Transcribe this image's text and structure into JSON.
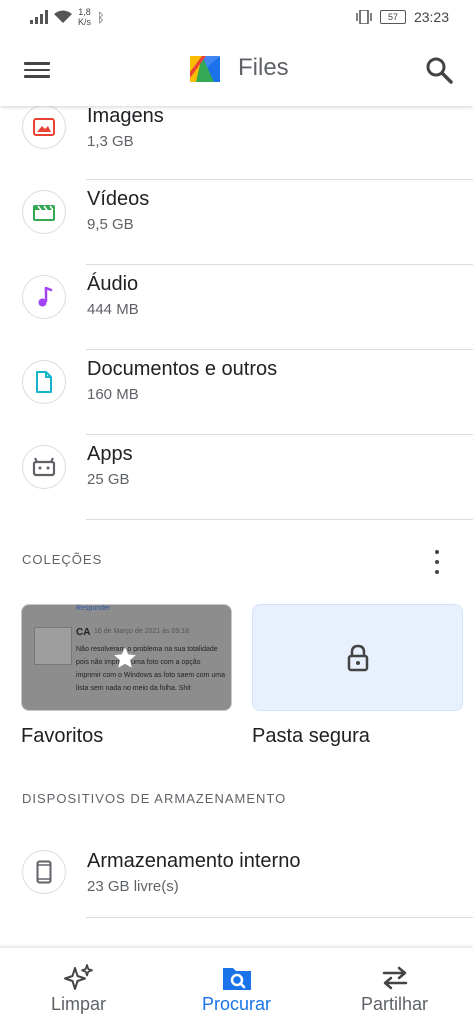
{
  "status_bar": {
    "speed_value": "1,8",
    "speed_unit": "K/s",
    "battery": "57",
    "time": "23:23"
  },
  "app_bar": {
    "title": "Files",
    "menu_icon": "hamburger-menu-icon",
    "search_icon": "search-icon",
    "logo_icon": "files-logo-icon"
  },
  "categories": [
    {
      "title": "Imagens",
      "subtitle": "1,3 GB",
      "icon": "image-icon",
      "color": "#ea4335"
    },
    {
      "title": "Vídeos",
      "subtitle": "9,5 GB",
      "icon": "video-icon",
      "color": "#34a853"
    },
    {
      "title": "Áudio",
      "subtitle": "444 MB",
      "icon": "music-note-icon",
      "color": "#a142f4"
    },
    {
      "title": "Documentos e outros",
      "subtitle": "160 MB",
      "icon": "document-icon",
      "color": "#12b5cb"
    },
    {
      "title": "Apps",
      "subtitle": "25 GB",
      "icon": "android-app-icon",
      "color": "#5f6368"
    }
  ],
  "collections": {
    "label": "COLEÇÕES",
    "favorites": {
      "label": "Favoritos",
      "thumb_reply": "Responder",
      "thumb_name": "CA",
      "thumb_date": "16 de Março de 2021 às 09:18",
      "thumb_text": "Não resolveram o problema na sua totalidade pois não imprimir uma foto com a opção imprimir com o Windows as foto saem com uma lista sem nada no meio da folha. Shit"
    },
    "safe_folder": {
      "label": "Pasta segura",
      "icon": "lock-icon"
    }
  },
  "storage": {
    "label": "DISPOSITIVOS DE ARMAZENAMENTO",
    "internal": {
      "title": "Armazenamento interno",
      "subtitle": "23 GB livre(s)",
      "icon": "phone-icon"
    }
  },
  "bottom_nav": [
    {
      "label": "Limpar",
      "icon": "sparkle-icon",
      "active": false
    },
    {
      "label": "Procurar",
      "icon": "browse-folder-search-icon",
      "active": true
    },
    {
      "label": "Partilhar",
      "icon": "swap-arrows-icon",
      "active": false
    }
  ],
  "colors": {
    "accent": "#1a73e8",
    "safe_folder_bg": "#e8f0fe"
  }
}
